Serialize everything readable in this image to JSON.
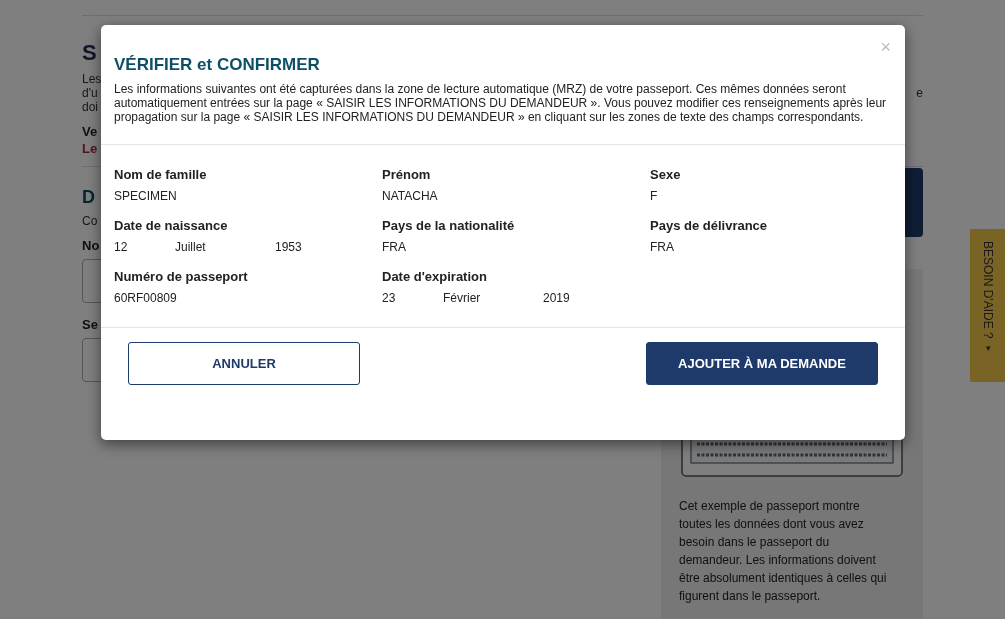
{
  "page": {
    "heading": "S",
    "intro_lines": [
      "Les",
      "d'u",
      "doi"
    ],
    "intro_line_end": "e",
    "notice": "Ve",
    "warning": "Le",
    "section_heading": "D",
    "section_intro": "Co",
    "field_labels": [
      "No",
      "Se"
    ]
  },
  "sidebar": {
    "help_text": "Cet exemple de passeport montre toutes les données dont vous avez besoin dans le passeport du demandeur. Les informations doivent être absolument identiques à celles qui figurent dans le passeport."
  },
  "help_tab": {
    "label": "BESOIN D'AIDE ?",
    "caret": "▾"
  },
  "modal": {
    "title": "VÉRIFIER et CONFIRMER",
    "close": "×",
    "intro": "Les informations suivantes ont été capturées dans la zone de lecture automatique (MRZ) de votre passeport. Ces mêmes données seront automatiquement entrées sur la page « SAISIR LES INFORMATIONS DU DEMANDEUR ». Vous pouvez modifier ces renseignements après leur propagation sur la page « SAISIR LES INFORMATIONS DU DEMANDEUR » en cliquant sur les zones de texte des champs correspondants.",
    "fields": [
      {
        "kind": "text",
        "label": "Nom de famille",
        "value": "SPECIMEN"
      },
      {
        "kind": "text",
        "label": "Prénom",
        "value": "NATACHA"
      },
      {
        "kind": "text",
        "label": "Sexe",
        "value": "F"
      },
      {
        "kind": "date",
        "label": "Date de naissance",
        "day": "12",
        "month": "Juillet",
        "year": "1953"
      },
      {
        "kind": "text",
        "label": "Pays de la nationalité",
        "value": "FRA"
      },
      {
        "kind": "text",
        "label": "Pays de délivrance",
        "value": "FRA"
      },
      {
        "kind": "text",
        "label": "Numéro de passeport",
        "value": "60RF00809"
      },
      {
        "kind": "date",
        "label": "Date d'expiration",
        "day": "23",
        "month": "Février",
        "year": "2019"
      }
    ],
    "buttons": [
      {
        "kind": "secondary",
        "label": "ANNULER"
      },
      {
        "kind": "primary",
        "label": "AJOUTER À MA DEMANDE"
      }
    ]
  }
}
